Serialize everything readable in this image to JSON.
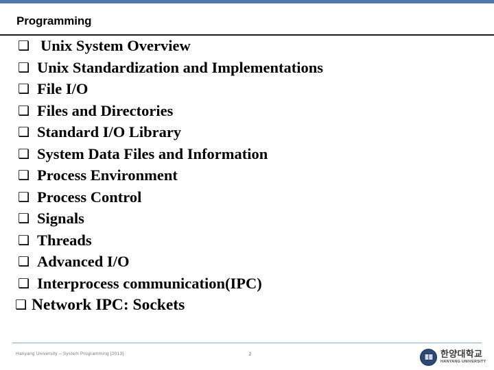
{
  "theme": {
    "accent_bar_color": "#4F77AB",
    "title_rule_color": "#1A1A1A",
    "footer_rule_color": "#8FA8C6",
    "text_color": "#000000",
    "footer_text_color": "#7B7B7B",
    "logo_seal_color": "#2E4A74"
  },
  "header": {
    "title": "Programming"
  },
  "body": {
    "bullet_glyph": "❑",
    "items": [
      {
        "label": "Unix System Overview",
        "indent": "wide"
      },
      {
        "label": "Unix Standardization and Implementations",
        "indent": "mid"
      },
      {
        "label": "File I/O",
        "indent": "mid"
      },
      {
        "label": "Files and Directories",
        "indent": "mid"
      },
      {
        "label": "Standard I/O Library",
        "indent": "mid"
      },
      {
        "label": "System Data Files and Information",
        "indent": "mid"
      },
      {
        "label": "Process Environment",
        "indent": "mid"
      },
      {
        "label": "Process Control",
        "indent": "mid"
      },
      {
        "label": "Signals",
        "indent": "mid"
      },
      {
        "label": "Threads",
        "indent": "mid"
      },
      {
        "label": "Advanced I/O",
        "indent": "mid"
      },
      {
        "label": "Interprocess communication(IPC)",
        "indent": "mid"
      },
      {
        "label": "Network IPC: Sockets",
        "indent": "tight"
      }
    ]
  },
  "footer": {
    "note": "Hanyang University – System Programming  [2013]",
    "page_number": "2",
    "logo": {
      "name_kr": "한양대학교",
      "name_en": "HANYANG UNIVERSITY"
    }
  }
}
